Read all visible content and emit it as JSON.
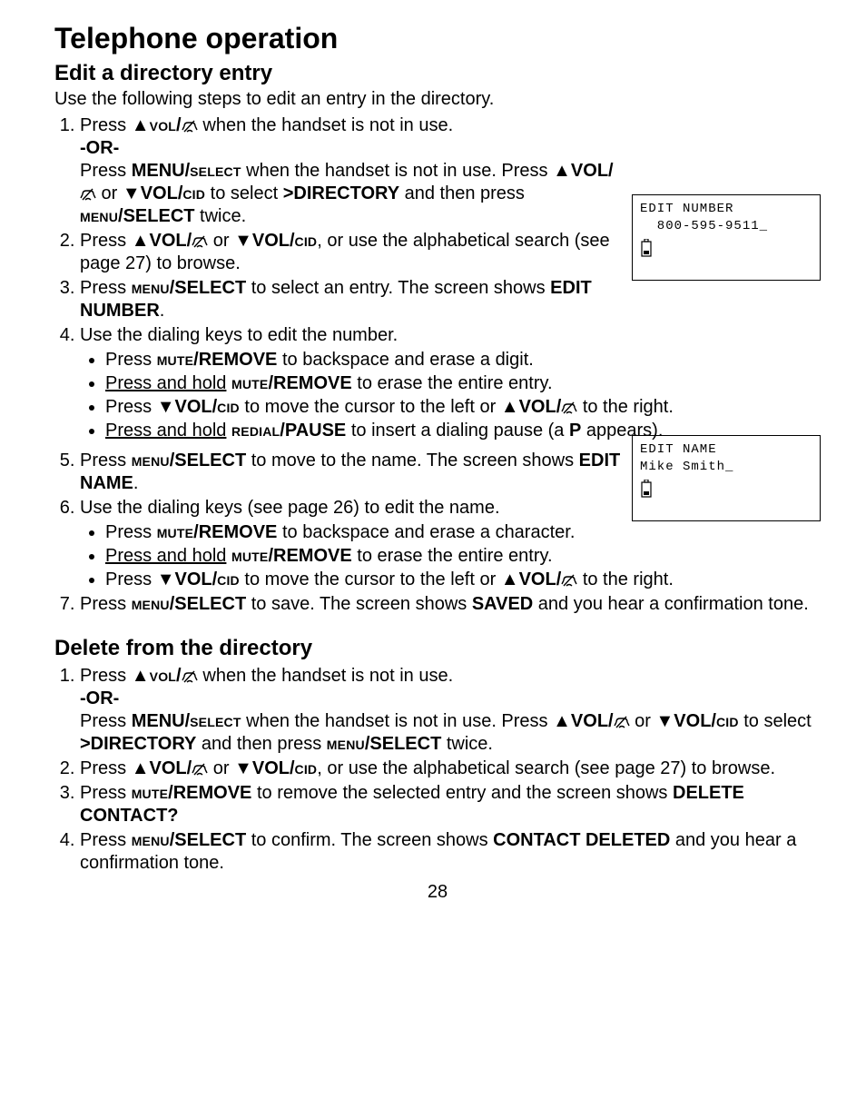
{
  "title": "Telephone operation",
  "section1": {
    "heading": "Edit a directory entry",
    "intro": "Use the following steps to edit an entry in the directory.",
    "step1_a": "Press ",
    "step1_b": " when the handset is not in use.",
    "step1_or": "-OR-",
    "step1_c1": "Press ",
    "step1_menu": "MENU/",
    "step1_select": "select",
    "step1_c2": " when the handset is not in use. Press ",
    "step1_vol": "▲VOL/",
    "step1_c3": " or ",
    "step1_voldown": "▼VOL/",
    "step1_cid": "cid",
    "step1_c4": " to select ",
    "step1_dir": ">DIRECTORY",
    "step1_c5": " and then press ",
    "step1_menu2": "menu",
    "step1_select2": "/SELECT",
    "step1_c6": " twice.",
    "step2_a": "Press ",
    "step2_b": " or ",
    "step2_c": ", or use the alphabetical search (see page 27) to browse.",
    "step3_a": "Press ",
    "step3_b": " to select an entry. The screen shows ",
    "step3_c": "EDIT NUMBER",
    "step3_d": ".",
    "step4": "Use the dialing keys to edit the number.",
    "step4_b1a": "Press ",
    "step4_mute": "mute",
    "step4_remove": "/REMOVE",
    "step4_b1b": " to backspace and erase a digit.",
    "step4_b2a": "Press and hold",
    "step4_b2b": " to erase the entire entry.",
    "step4_b3a": "Press ",
    "step4_b3b": " to move the cursor to the left or ",
    "step4_b3c": " to the right.",
    "step4_b4a": "Press and hold",
    "step4_redial": "redial",
    "step4_pause": "/PAUSE",
    "step4_b4b": " to insert a dialing pause (a ",
    "step4_b4p": "P",
    "step4_b4c": " appears).",
    "step5_a": "Press ",
    "step5_b": " to move to the name. The screen shows ",
    "step5_c": "EDIT NAME",
    "step5_d": ".",
    "step6": "Use the dialing keys (see page 26) to edit the name.",
    "step6_b1": " to backspace and erase a character.",
    "step6_b2": " to erase the entire entry.",
    "step6_b3a": "Press ",
    "step6_b3b": " to move the cursor to the left or ",
    "step6_b3c": " to the right.",
    "step7_a": "Press ",
    "step7_b": " to save. The screen shows ",
    "step7_c": "SAVED",
    "step7_d": " and you hear a confirmation tone."
  },
  "section2": {
    "heading": "Delete from the directory",
    "step1_a": "Press ",
    "step1_b": " when the handset is not in use.",
    "step1_or": "-OR-",
    "step1_c1": "Press ",
    "step1_c2": " when the handset is not in use. Press ",
    "step1_c3": " or ",
    "step1_c4": "  to select ",
    "step1_dir": ">DIRECTORY",
    "step1_c5": " and then press ",
    "step1_c6": " twice.",
    "step2_a": "Press ",
    "step2_b": " or ",
    "step2_c": ", or use the alphabetical search (see page 27) to browse.",
    "step3_a": "Press ",
    "step3_b": " to remove the selected entry and the screen shows ",
    "step3_c": "DELETE CONTACT?",
    "step4_a": "Press ",
    "step4_b": " to confirm. The screen shows ",
    "step4_c": "CONTACT DELETED",
    "step4_d": " and you hear a confirmation tone."
  },
  "screen1": {
    "l1": "EDIT NUMBER",
    "l2": "  800-595-9511_"
  },
  "screen2": {
    "l1": "EDIT NAME",
    "l2": "Mike Smith_"
  },
  "pagenum": "28",
  "labels": {
    "volup_sc": "▲vol/",
    "VOLUP": "▲VOL/",
    "VOLDOWN": "▼VOL/",
    "voldown_cid": "▼VOL/cid",
    "mute_remove": "mute/REMOVE",
    "menu_select": "menu/SELECT",
    "MENU_select": "MENU/select"
  }
}
